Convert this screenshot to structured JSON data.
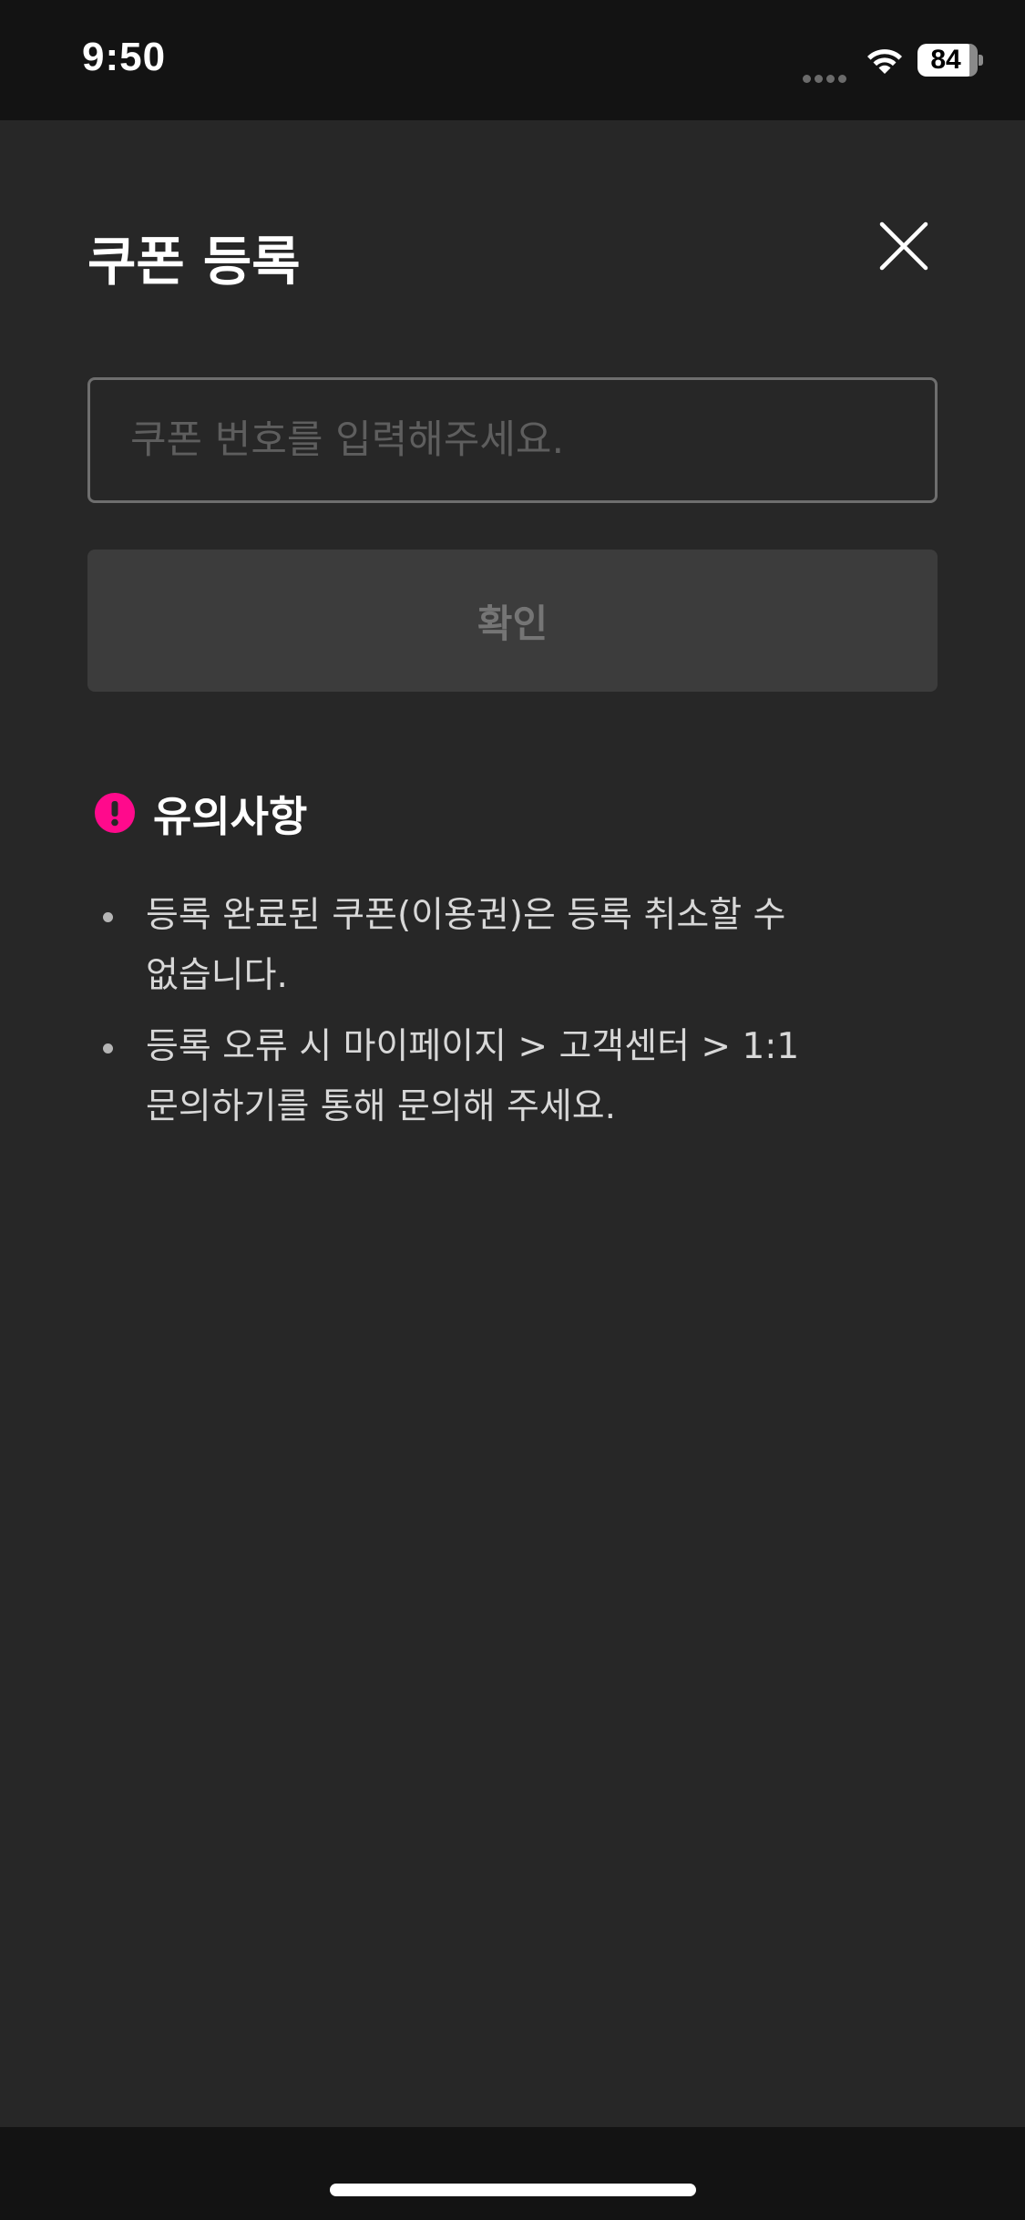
{
  "status_bar": {
    "time": "9:50",
    "battery_level": "84"
  },
  "sheet": {
    "title": "쿠폰 등록",
    "input_placeholder": "쿠폰 번호를 입력해주세요.",
    "input_value": "",
    "confirm_label": "확인",
    "notice_title": "유의사항",
    "notice_items": [
      "등록 완료된 쿠폰(이용권)은 등록 취소할 수 없습니다.",
      "등록 오류 시 마이페이지 > 고객센터 > 1:1 문의하기를 통해 문의해 주세요."
    ]
  },
  "colors": {
    "sheet_background": "#272727",
    "status_background": "#131313",
    "accent_alert": "#ff0a8c",
    "button_disabled": "#3c3c3c"
  },
  "icons": {
    "close": "close-icon",
    "alert": "exclamation-circle-icon",
    "wifi": "wifi-icon"
  }
}
